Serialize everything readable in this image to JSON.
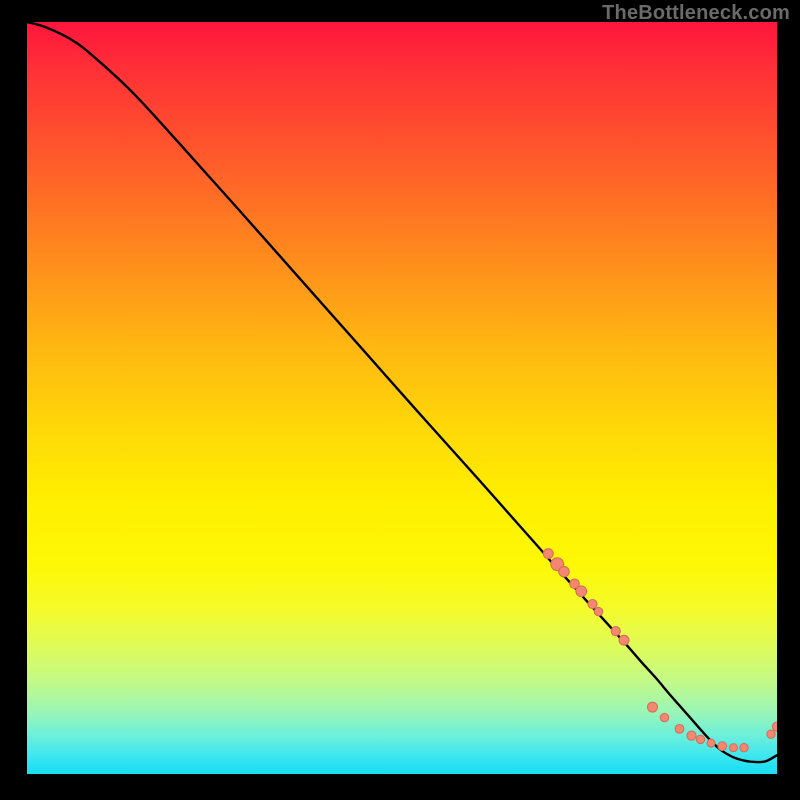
{
  "watermark": "TheBottleneck.com",
  "colors": {
    "background": "#000000",
    "curve": "#000000",
    "marker_fill": "#f4876f",
    "marker_stroke": "#d36b57",
    "watermark_text": "#6a6a6a"
  },
  "chart_data": {
    "type": "line",
    "title": "",
    "xlabel": "",
    "ylabel": "",
    "xlim": [
      0,
      100
    ],
    "ylim": [
      0,
      100
    ],
    "grid": false,
    "legend": false,
    "series": [
      {
        "name": "bottleneck-curve",
        "x": [
          0,
          2.5,
          6,
          9,
          14,
          20,
          28,
          36,
          44,
          52,
          60,
          68,
          70,
          72,
          74,
          76,
          78,
          80,
          82,
          84,
          85.5,
          87,
          88.5,
          90,
          91.3,
          92.5,
          94,
          95.5,
          97,
          98.5,
          100
        ],
        "y": [
          100,
          99.3,
          97.6,
          95.3,
          90.7,
          84.2,
          75.3,
          66.3,
          57.3,
          48.3,
          39.4,
          30.4,
          28.1,
          25.9,
          23.7,
          21.5,
          19.3,
          17.1,
          14.8,
          12.6,
          10.8,
          9.1,
          7.4,
          5.7,
          4.3,
          3.2,
          2.3,
          1.8,
          1.6,
          1.7,
          2.5
        ]
      }
    ],
    "markers": [
      {
        "name": "cluster-upper",
        "points": [
          {
            "x": 69.5,
            "y": 29.3,
            "r": 5.0
          },
          {
            "x": 70.7,
            "y": 27.9,
            "r": 6.4
          },
          {
            "x": 71.6,
            "y": 26.9,
            "r": 5.2
          },
          {
            "x": 73.0,
            "y": 25.3,
            "r": 4.8
          },
          {
            "x": 73.9,
            "y": 24.3,
            "r": 5.4
          },
          {
            "x": 75.4,
            "y": 22.6,
            "r": 4.6
          },
          {
            "x": 76.2,
            "y": 21.6,
            "r": 4.2
          }
        ]
      },
      {
        "name": "cluster-gap",
        "points": [
          {
            "x": 78.5,
            "y": 19.0,
            "r": 4.6
          },
          {
            "x": 79.6,
            "y": 17.8,
            "r": 5.0
          }
        ]
      },
      {
        "name": "cluster-valley",
        "points": [
          {
            "x": 83.4,
            "y": 8.9,
            "r": 5.0
          },
          {
            "x": 85.0,
            "y": 7.5,
            "r": 4.2
          },
          {
            "x": 87.0,
            "y": 6.0,
            "r": 4.4
          },
          {
            "x": 88.6,
            "y": 5.1,
            "r": 4.6
          },
          {
            "x": 89.8,
            "y": 4.6,
            "r": 4.2
          },
          {
            "x": 91.2,
            "y": 4.1,
            "r": 4.0
          },
          {
            "x": 92.7,
            "y": 3.7,
            "r": 4.4
          },
          {
            "x": 94.2,
            "y": 3.5,
            "r": 4.0
          },
          {
            "x": 95.6,
            "y": 3.5,
            "r": 4.2
          }
        ]
      },
      {
        "name": "cluster-tail",
        "points": [
          {
            "x": 99.2,
            "y": 5.3,
            "r": 4.2
          },
          {
            "x": 100.0,
            "y": 6.3,
            "r": 4.6
          }
        ]
      }
    ]
  }
}
